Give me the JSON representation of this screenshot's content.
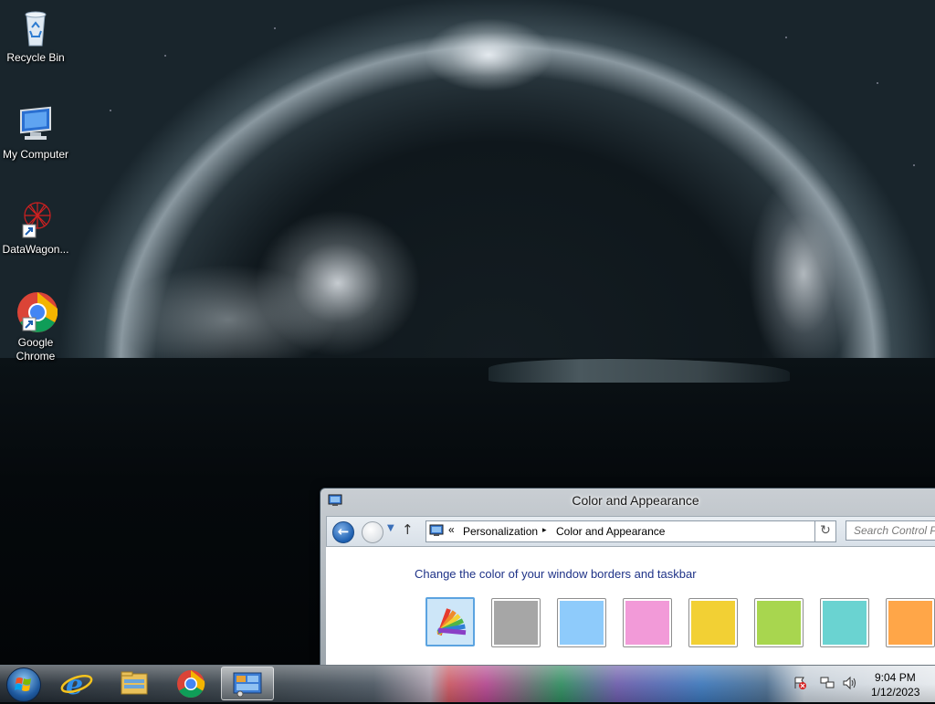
{
  "desktop": {
    "icons": [
      {
        "label": "Recycle Bin",
        "icon": "recycle-bin-icon"
      },
      {
        "label": "My Computer",
        "icon": "computer-icon"
      },
      {
        "label": "DataWagon...",
        "icon": "datawagon-icon"
      },
      {
        "label": "Google Chrome",
        "icon": "chrome-icon"
      }
    ]
  },
  "window": {
    "title": "Color and Appearance",
    "address": {
      "chevron": "«",
      "crumbs": [
        "Personalization",
        "Color and Appearance"
      ],
      "separator": "▸"
    },
    "search_placeholder": "Search Control Panel",
    "heading": "Change the color of your window borders and taskbar",
    "swatches": [
      {
        "name": "automatic",
        "color": "#8fc8f5",
        "selected": true
      },
      {
        "name": "gray",
        "color": "#a6a6a6"
      },
      {
        "name": "sky",
        "color": "#8ecbfb"
      },
      {
        "name": "pink",
        "color": "#f29ad8"
      },
      {
        "name": "yellow",
        "color": "#f2d034"
      },
      {
        "name": "lime",
        "color": "#a8d64f"
      },
      {
        "name": "teal",
        "color": "#6ad3d1"
      },
      {
        "name": "orange",
        "color": "#ffa648"
      }
    ]
  },
  "taskbar": {
    "buttons": [
      {
        "name": "internet-explorer",
        "icon": "ie-icon"
      },
      {
        "name": "file-explorer",
        "icon": "folder-icon"
      },
      {
        "name": "google-chrome",
        "icon": "chrome-icon"
      },
      {
        "name": "control-panel",
        "icon": "control-panel-icon",
        "active": true
      }
    ],
    "tray_icons": [
      "action-center-icon",
      "network-icon",
      "volume-icon"
    ],
    "clock": {
      "time": "9:04 PM",
      "date": "1/12/2023"
    }
  },
  "colors": {
    "heading": "#1e3287",
    "selected_border": "#5ba3e0"
  }
}
